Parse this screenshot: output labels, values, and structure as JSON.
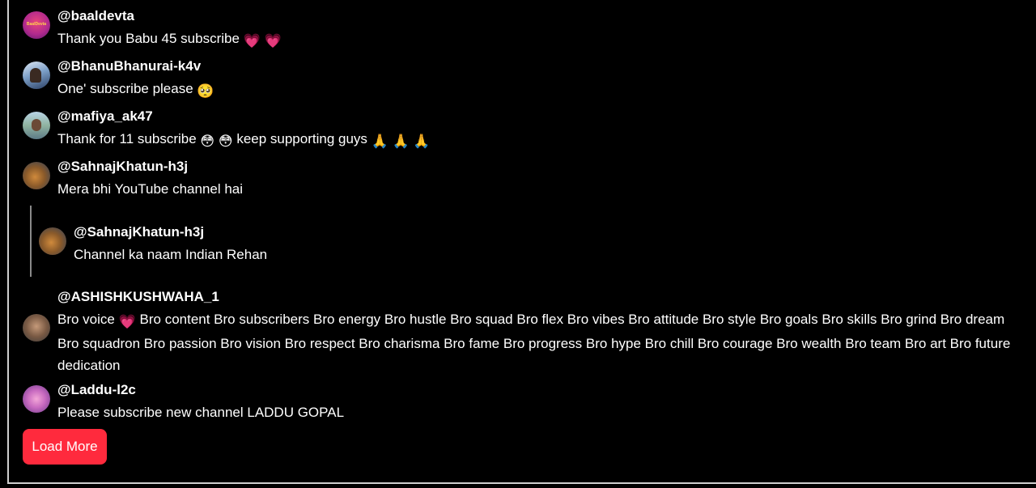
{
  "comments": [
    {
      "author": "@baaldevta",
      "text": "Thank you Babu 45 subscribe",
      "emojis": "💗 💗",
      "avatar_text": "BaalDevta"
    },
    {
      "author": "@BhanuBhanurai-k4v",
      "text": "One' subscribe please",
      "emojis": "🥺"
    },
    {
      "author": "@mafiya_ak47",
      "text_a": "Thank for 11 subscribe",
      "emojis_a": "😳 😳",
      "text_b": "keep supporting guys",
      "emojis_b": "🙏 🙏 🙏"
    },
    {
      "author": "@SahnajKhatun-h3j",
      "text": "Mera bhi YouTube channel hai"
    },
    {
      "author": "@ASHISHKUSHWAHA_1",
      "line1_a": "Bro voice",
      "line1_emoji": "💗",
      "line1_b": "Bro content Bro subscribers Bro energy Bro hustle Bro squad Bro flex Bro vibes Bro attitude Bro style Bro goals Bro skills Bro grind Bro dream",
      "line2": "Bro squadron Bro passion Bro vision Bro respect Bro charisma Bro fame Bro progress Bro hype Bro chill Bro courage Bro wealth Bro team Bro art Bro future",
      "line3": "dedication"
    },
    {
      "author": "@Laddu-l2c",
      "text": "Please subscribe new channel LADDU GOPAL"
    }
  ],
  "reply": {
    "author": "@SahnajKhatun-h3j",
    "text": "Channel ka naam Indian Rehan"
  },
  "load_more_label": "Load More"
}
